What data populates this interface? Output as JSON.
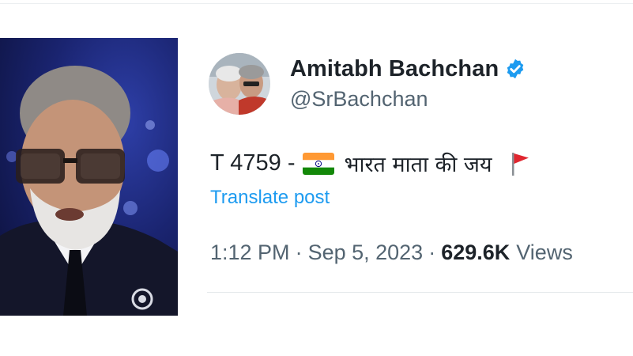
{
  "colors": {
    "accent": "#1d9bf0",
    "text_primary": "#1d2329",
    "text_secondary": "#536471",
    "verified_badge": "#1d9bf0",
    "photo_background": "#1a2470"
  },
  "photo": {
    "subject_icon": "portrait-image"
  },
  "tweet": {
    "display_name": "Amitabh Bachchan",
    "verified_icon": "verified-badge-icon",
    "handle": "@SrBachchan",
    "text_prefix": "T 4759 -",
    "flag_icon": "india-flag-icon",
    "text_hindi": "भारत माता की जय",
    "trailing_icon": "red-flag-icon",
    "translate_label": "Translate post",
    "time": "1:12 PM",
    "separator": "·",
    "date": "Sep 5, 2023",
    "views_count": "629.6K",
    "views_label": "Views"
  }
}
